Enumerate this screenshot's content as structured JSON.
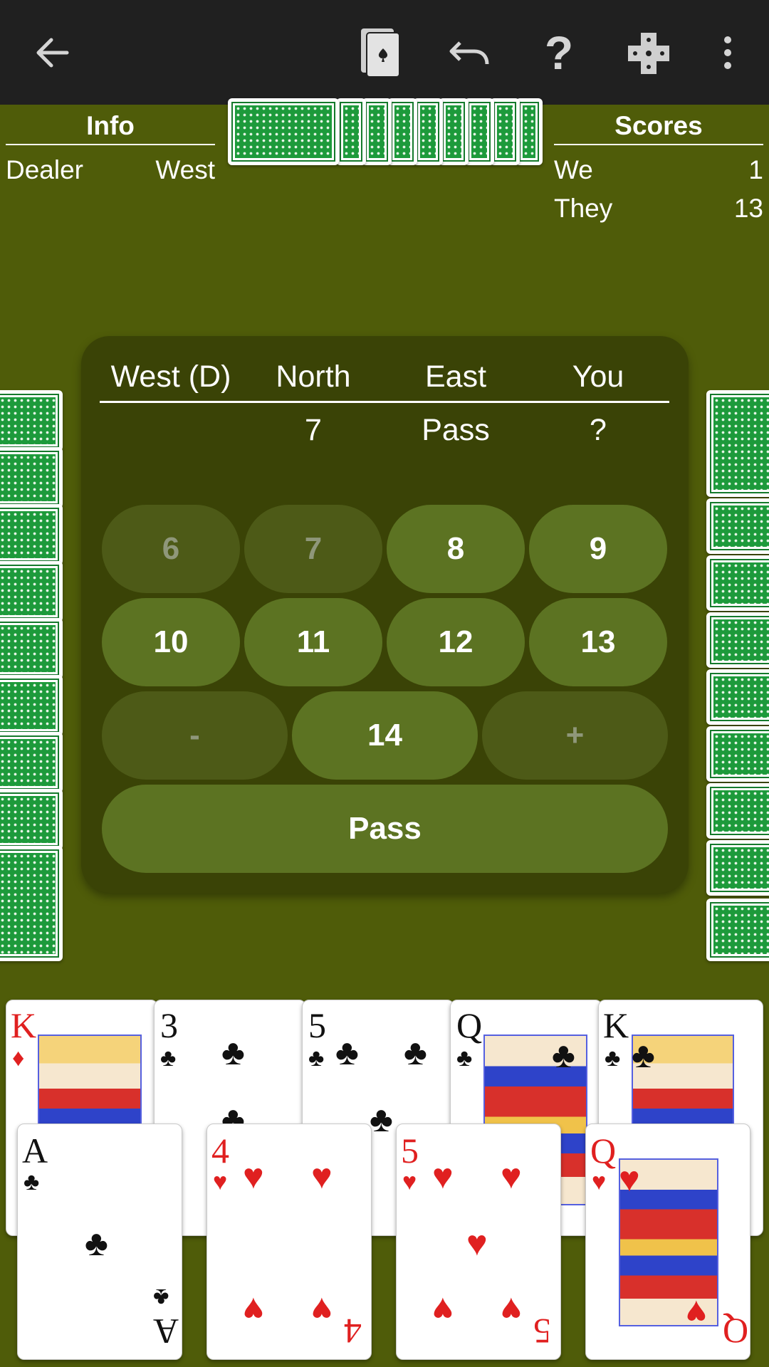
{
  "info": {
    "title": "Info",
    "dealer_label": "Dealer",
    "dealer_value": "West"
  },
  "scores": {
    "title": "Scores",
    "we_label": "We",
    "we_value": "1",
    "they_label": "They",
    "they_value": "13"
  },
  "bidding": {
    "headers": [
      "West (D)",
      "North",
      "East",
      "You"
    ],
    "bids": [
      "",
      "7",
      "Pass",
      "?"
    ],
    "buttons_row1": [
      "6",
      "7",
      "8",
      "9"
    ],
    "buttons_row2": [
      "10",
      "11",
      "12",
      "13"
    ],
    "minus": "-",
    "current": "14",
    "plus": "+",
    "pass": "Pass"
  },
  "toolbar": {
    "icons": [
      "back-arrow-icon",
      "cards-icon",
      "undo-icon",
      "help-icon",
      "puzzle-icon",
      "more-vert-icon"
    ]
  },
  "hand_back_row": [
    {
      "rank": "K",
      "suit": "♦",
      "color": "red"
    },
    {
      "rank": "3",
      "suit": "♣",
      "color": "black"
    },
    {
      "rank": "5",
      "suit": "♣",
      "color": "black"
    },
    {
      "rank": "Q",
      "suit": "♣",
      "color": "black"
    },
    {
      "rank": "K",
      "suit": "♣",
      "color": "black"
    }
  ],
  "hand_front_row": [
    {
      "rank": "A",
      "suit": "♣",
      "color": "black"
    },
    {
      "rank": "4",
      "suit": "♥",
      "color": "red"
    },
    {
      "rank": "5",
      "suit": "♥",
      "color": "red"
    },
    {
      "rank": "Q",
      "suit": "♥",
      "color": "red"
    }
  ],
  "colors": {
    "table": "#4f5c09",
    "panel": "#3a4306",
    "button": "#5c7322",
    "button_disabled": "#4d5a17",
    "appbar": "#202020"
  }
}
